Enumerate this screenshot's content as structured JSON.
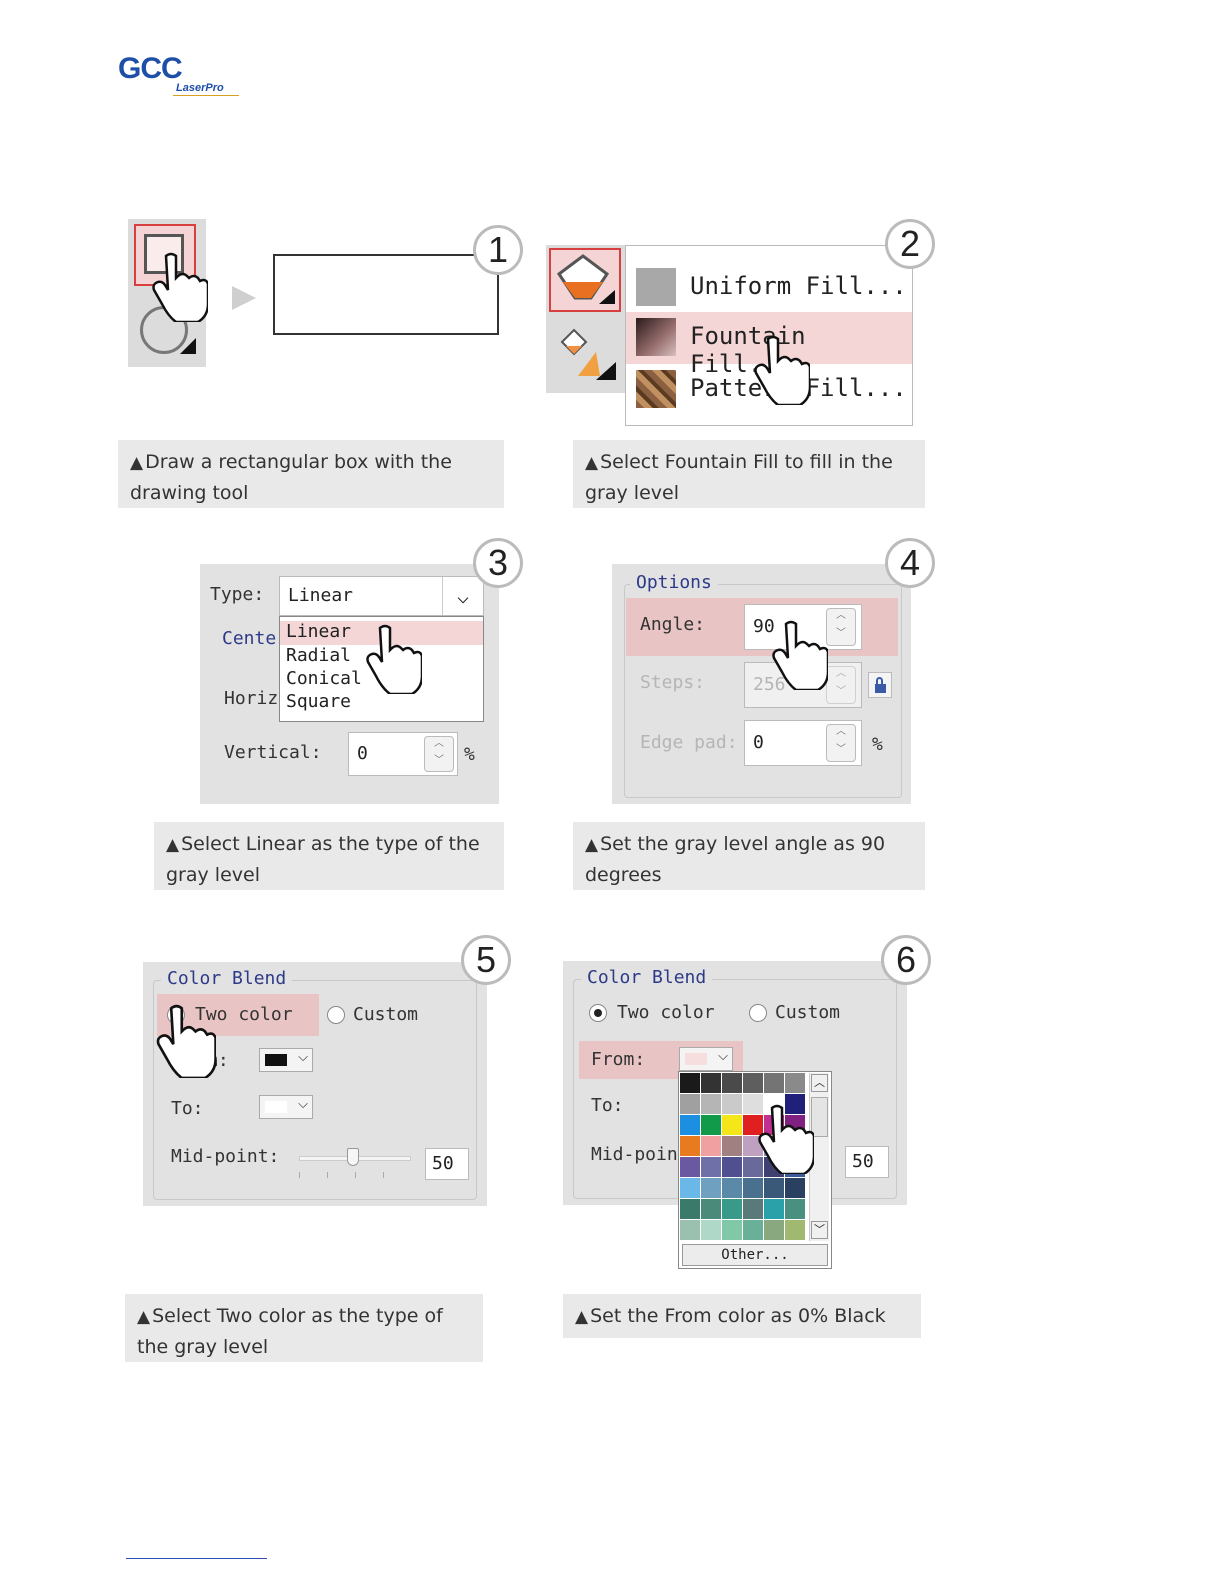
{
  "logo": {
    "brand": "GCC",
    "sub": "LaserPro"
  },
  "steps": [
    {
      "number": "1",
      "caption": "Draw a rectangular box with the drawing tool"
    },
    {
      "number": "2",
      "caption": "Select Fountain Fill to fill in the gray level"
    },
    {
      "number": "3",
      "caption": "Select Linear as the type of the gray level"
    },
    {
      "number": "4",
      "caption": "Set the gray level angle as 90 degrees"
    },
    {
      "number": "5",
      "caption": "Select Two color as the type of the gray level"
    },
    {
      "number": "6",
      "caption": "Set the From color as 0% Black"
    }
  ],
  "caption_marker": "▲",
  "fill_menu": {
    "items": [
      "Uniform Fill...",
      "Fountain Fill...",
      "Pattern Fill..."
    ]
  },
  "type_panel": {
    "type_label": "Type:",
    "type_value": "Linear",
    "options": [
      "Linear",
      "Radial",
      "Conical",
      "Square"
    ],
    "center_label": "Cente",
    "horiz_label": "Horiz",
    "vertical_label": "Vertical:",
    "vertical_value": "0",
    "unit": "%"
  },
  "options_panel": {
    "title": "Options",
    "angle_label": "Angle:",
    "angle_value": "90",
    "steps_label": "Steps:",
    "steps_value": "256",
    "edge_label": "Edge pad:",
    "edge_value": "0",
    "unit": "%"
  },
  "blend_panel_5": {
    "title": "Color Blend",
    "two_color": "Two color",
    "custom": "Custom",
    "from_partial": "m:",
    "to_label": "To:",
    "midpoint_label": "Mid-point:",
    "midpoint_value": "50"
  },
  "blend_panel_6": {
    "title": "Color Blend",
    "two_color": "Two color",
    "custom": "Custom",
    "from_label": "From:",
    "to_label": "To:",
    "midpoint_label": "Mid-poin",
    "midpoint_value": "50",
    "other_button": "Other..."
  },
  "palette_colors": [
    [
      "#1a1a1a",
      "#333333",
      "#4a4a4a",
      "#5e5e5e",
      "#747474",
      "#8a8a8a"
    ],
    [
      "#a0a0a0",
      "#b5b5b5",
      "#cacaca",
      "#dedede",
      "#ffffff",
      "#20207a"
    ],
    [
      "#1c8fe0",
      "#109a4a",
      "#f5e61a",
      "#e02020",
      "#c03090",
      "#802080"
    ],
    [
      "#e87a20",
      "#f0a0a0",
      "#a08080",
      "#c0a0c0",
      "#9090c0",
      "#5050a0"
    ],
    [
      "#6a58a0",
      "#7070a8",
      "#505090",
      "#6a6a9a",
      "#404070",
      "#3a5a9a"
    ],
    [
      "#6ab8e8",
      "#70a0c0",
      "#5a8aa8",
      "#4a7090",
      "#3a5878",
      "#2a4060"
    ],
    [
      "#3a7a6a",
      "#4a8a7a",
      "#3a9a8a",
      "#5a7a7a",
      "#2aa0a8",
      "#4a9080"
    ],
    [
      "#9ac0b0",
      "#b0d8c8",
      "#80c8a8",
      "#6ab098",
      "#8aa880",
      "#a0b870"
    ]
  ]
}
